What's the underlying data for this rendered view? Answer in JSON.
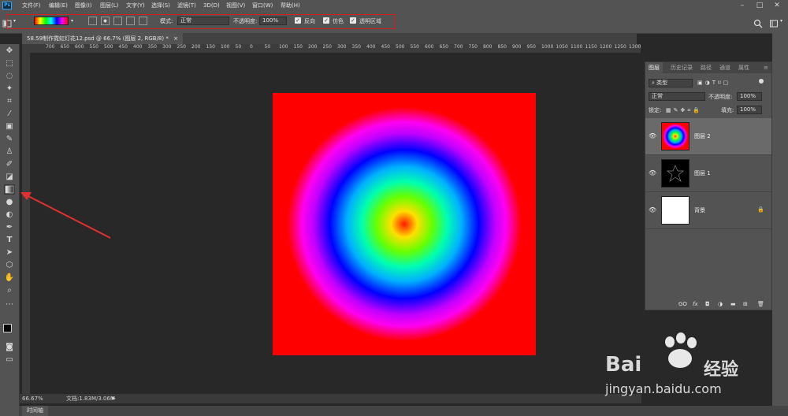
{
  "app": {
    "logo": "Ps"
  },
  "menu": [
    "文件(F)",
    "编辑(E)",
    "图像(I)",
    "图层(L)",
    "文字(Y)",
    "选择(S)",
    "滤镜(T)",
    "3D(D)",
    "视图(V)",
    "窗口(W)",
    "帮助(H)"
  ],
  "options": {
    "mode_label": "模式:",
    "mode_value": "正常",
    "opacity_label": "不透明度:",
    "opacity_value": "100%",
    "reverse_label": "反向",
    "dither_label": "仿色",
    "transparency_label": "透明区域"
  },
  "document": {
    "tab_title": "58.59制作霓虹灯花12.psd @ 66.7% (图层 2, RGB/8) *"
  },
  "ruler_labels": [
    "700",
    "650",
    "600",
    "550",
    "500",
    "450",
    "400",
    "350",
    "300",
    "250",
    "200",
    "150",
    "100",
    "50",
    "0",
    "50",
    "100",
    "150",
    "200",
    "250",
    "300",
    "350",
    "400",
    "450",
    "500",
    "550",
    "600",
    "650",
    "700",
    "750",
    "800",
    "850",
    "900",
    "950",
    "1000",
    "1050",
    "1100",
    "1150",
    "1200",
    "1250",
    "1300",
    "1350"
  ],
  "status": {
    "zoom": "66.67%",
    "doc_info": "文档:1.83M/3.06M"
  },
  "timeline": {
    "label": "时间轴"
  },
  "layers_panel": {
    "tabs": [
      "图层",
      "历史记录",
      "路径",
      "通道",
      "属性"
    ],
    "filter_label": "类型",
    "blend_mode": "正常",
    "opacity_label": "不透明度:",
    "opacity_value": "100%",
    "lock_label": "锁定:",
    "fill_label": "填充:",
    "fill_value": "100%",
    "layers": [
      {
        "name": "图层 2"
      },
      {
        "name": "图层 1"
      },
      {
        "name": "背景"
      }
    ],
    "footer_icons": [
      "GO",
      "fx"
    ]
  },
  "watermark": {
    "brand": "Bai",
    "brand2": "经验",
    "url": "jingyan.baidu.com"
  },
  "colors": {
    "canvas_red": "#ff0000",
    "highlight_box": "#d21f1f",
    "arrow": "#e23030"
  }
}
